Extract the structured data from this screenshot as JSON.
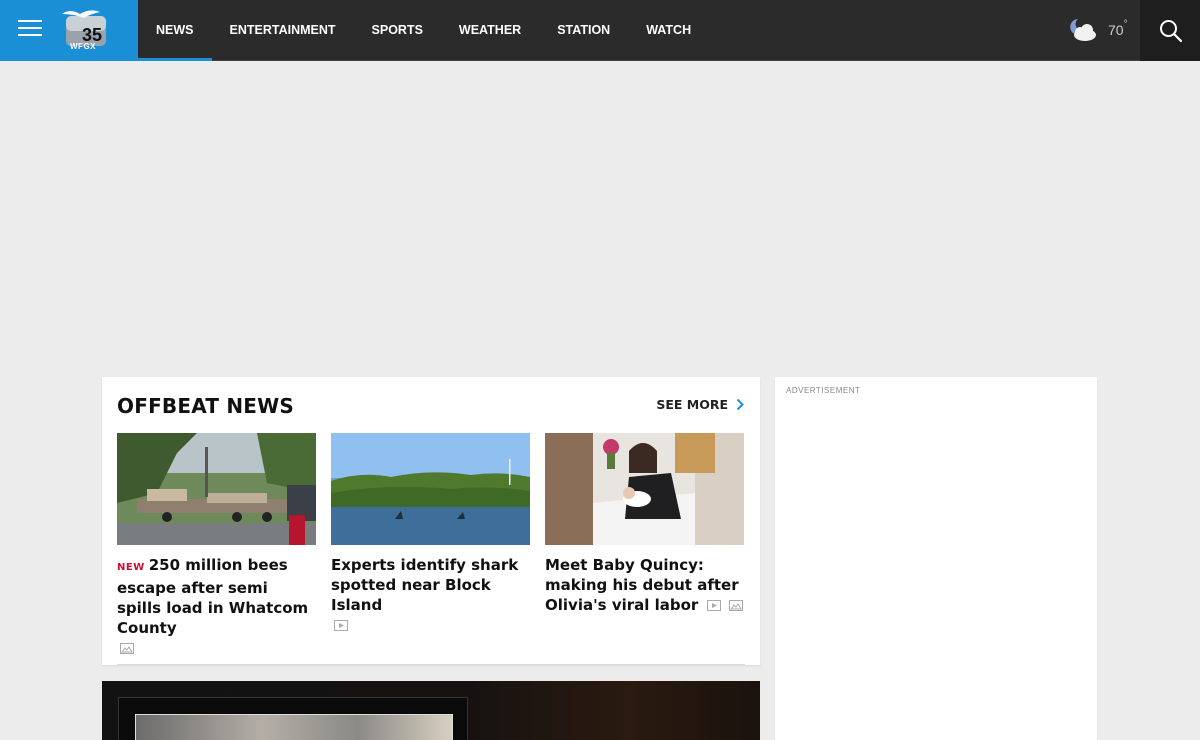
{
  "station": {
    "logo_number": "35",
    "logo_callsign": "WFGX"
  },
  "nav": {
    "items": [
      {
        "label": "NEWS",
        "active": true
      },
      {
        "label": "ENTERTAINMENT"
      },
      {
        "label": "SPORTS"
      },
      {
        "label": "WEATHER"
      },
      {
        "label": "STATION"
      },
      {
        "label": "WATCH"
      }
    ]
  },
  "weather": {
    "temp": "70",
    "deg": "°",
    "icon": "partly-cloudy-night-icon"
  },
  "offbeat": {
    "title": "OFFBEAT NEWS",
    "see_more": "SEE MORE",
    "stories": [
      {
        "tag": "NEW",
        "headline": "250 million bees escape after semi spills load in Whatcom County",
        "media": [
          "gallery-icon"
        ]
      },
      {
        "tag": "",
        "headline": "Experts identify shark spotted near Block Island",
        "media": [
          "video-icon"
        ]
      },
      {
        "tag": "",
        "headline": "Meet Baby Quincy: making his debut after Olivia's viral labor",
        "media": [
          "video-icon",
          "gallery-icon"
        ]
      }
    ]
  },
  "ad": {
    "label": "ADVERTISEMENT"
  },
  "colors": {
    "brand_blue": "#1a8fd6",
    "nav_bg": "#2b2b2b",
    "new_tag": "#c8102e"
  }
}
